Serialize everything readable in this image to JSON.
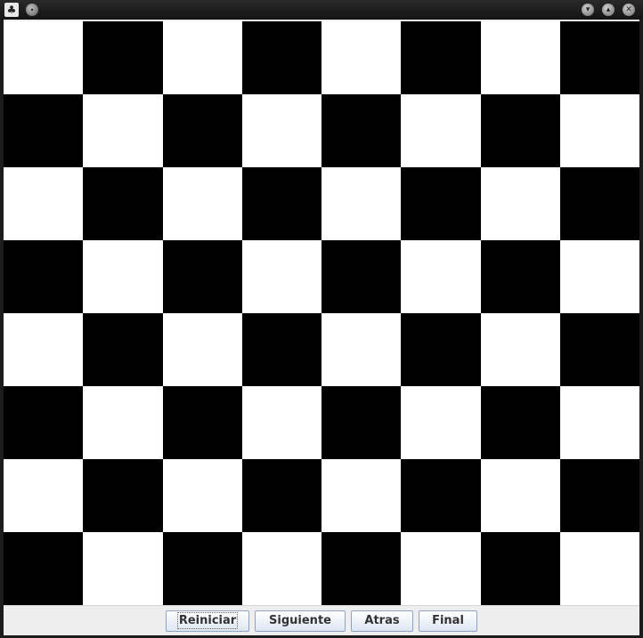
{
  "window": {
    "title": "",
    "icon": "app-icon",
    "menu_icon": "window-menu-icon",
    "controls": {
      "minimize_icon": "minimize-icon",
      "maximize_icon": "maximize-icon",
      "close_icon": "close-icon"
    }
  },
  "board": {
    "rows": 8,
    "cols": 8,
    "dark_color": "#000000",
    "light_color": "#ffffff",
    "top_left": "light"
  },
  "buttons": {
    "restart": "Reiniciar",
    "next": "Siguiente",
    "back": "Atras",
    "end": "Final"
  }
}
